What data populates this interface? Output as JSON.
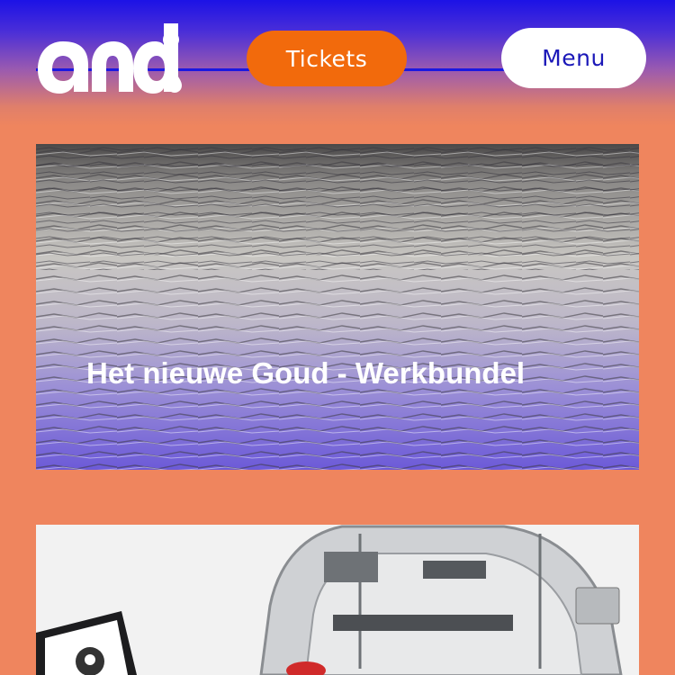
{
  "header": {
    "logo_text": "and:",
    "tickets_label": "Tickets",
    "menu_label": "Menu"
  },
  "cards": [
    {
      "title": "Het nieuwe Goud - Werkbundel",
      "image": "stacked-paper-sheets-photo"
    },
    {
      "title": "",
      "image": "3d-printer-photo"
    }
  ],
  "colors": {
    "background": "#ef855e",
    "gradient_top": "#1c12e6",
    "tickets_button": "#f26a0c",
    "menu_button": "#ffffff",
    "menu_text": "#1b18b8",
    "accent_line": "#1b18e0"
  }
}
